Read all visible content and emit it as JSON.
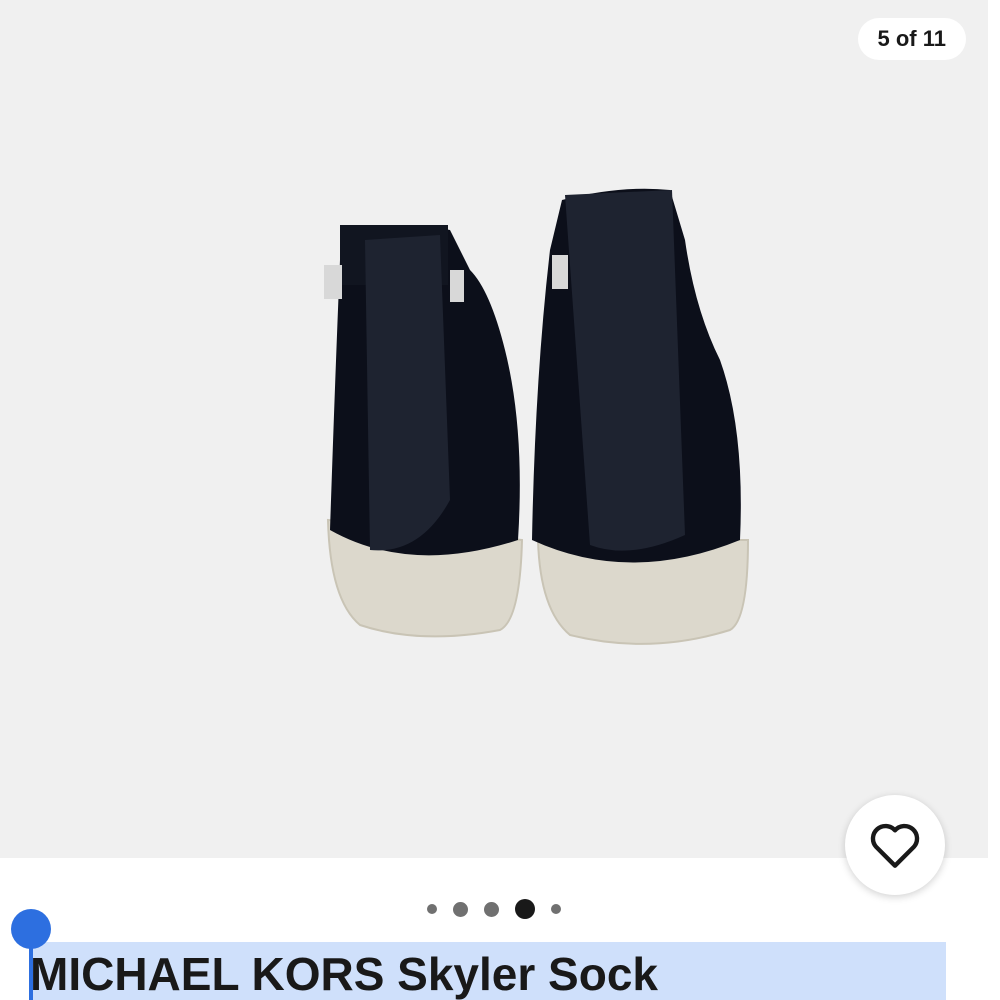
{
  "gallery": {
    "counter": "5 of 11",
    "image_alt": "Rear view of black sock sneakers with white soles",
    "total_images": 11,
    "current_image": 5
  },
  "actions": {
    "watch_icon": "heart-icon"
  },
  "pagination": {
    "dot_count": 5,
    "active_index": 3
  },
  "listing": {
    "title": "MICHAEL KORS Skyler Sock"
  },
  "colors": {
    "gallery_bg": "#f0f0f0",
    "selection_highlight": "#cfe0fb",
    "selection_handle": "#2d6fe0",
    "text": "#191919"
  }
}
